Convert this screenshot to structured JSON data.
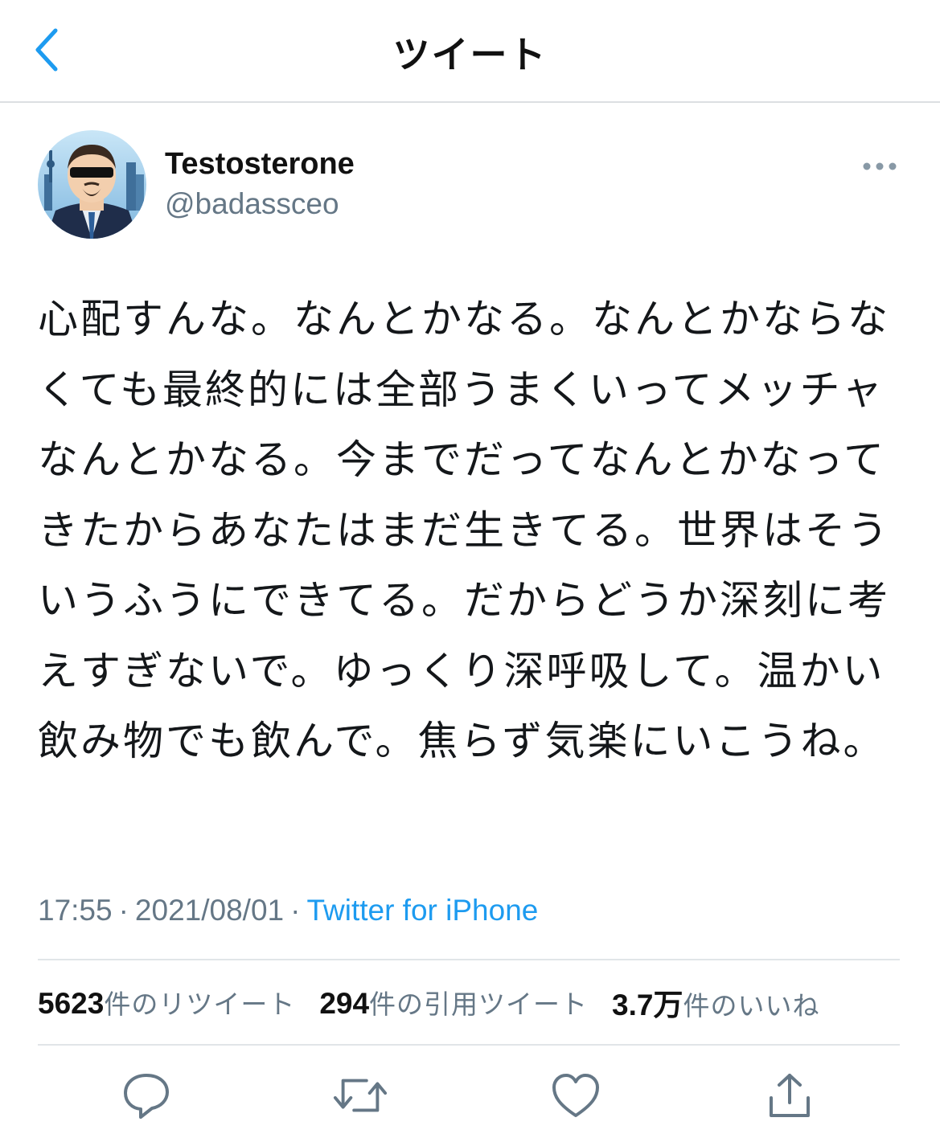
{
  "header": {
    "title": "ツイート"
  },
  "tweet": {
    "display_name": "Testosterone",
    "handle": "@badassceo",
    "text": "心配すんな。なんとかなる。なんとかならなくても最終的には全部うまくいってメッチャなんとかなる。今までだってなんとかなってきたからあなたはまだ生きてる。世界はそういうふうにできてる。だからどうか深刻に考えすぎないで。ゆっくり深呼吸して。温かい飲み物でも飲んで。焦らず気楽にいこうね。",
    "time": "17:55",
    "date": "2021/08/01",
    "separator": "·",
    "source": "Twitter for iPhone"
  },
  "stats": {
    "retweets_count": "5623",
    "retweets_label": "件のリツイート",
    "quotes_count": "294",
    "quotes_label": "件の引用ツイート",
    "likes_count": "3.7万",
    "likes_label": "件のいいね"
  },
  "colors": {
    "accent": "#1d9bf0",
    "secondary_text": "#657786",
    "icon_gray": "#657786"
  },
  "icons": {
    "back": "chevron-left-icon",
    "more": "more-icon",
    "reply": "reply-icon",
    "retweet": "retweet-icon",
    "like": "heart-icon",
    "share": "share-icon"
  }
}
